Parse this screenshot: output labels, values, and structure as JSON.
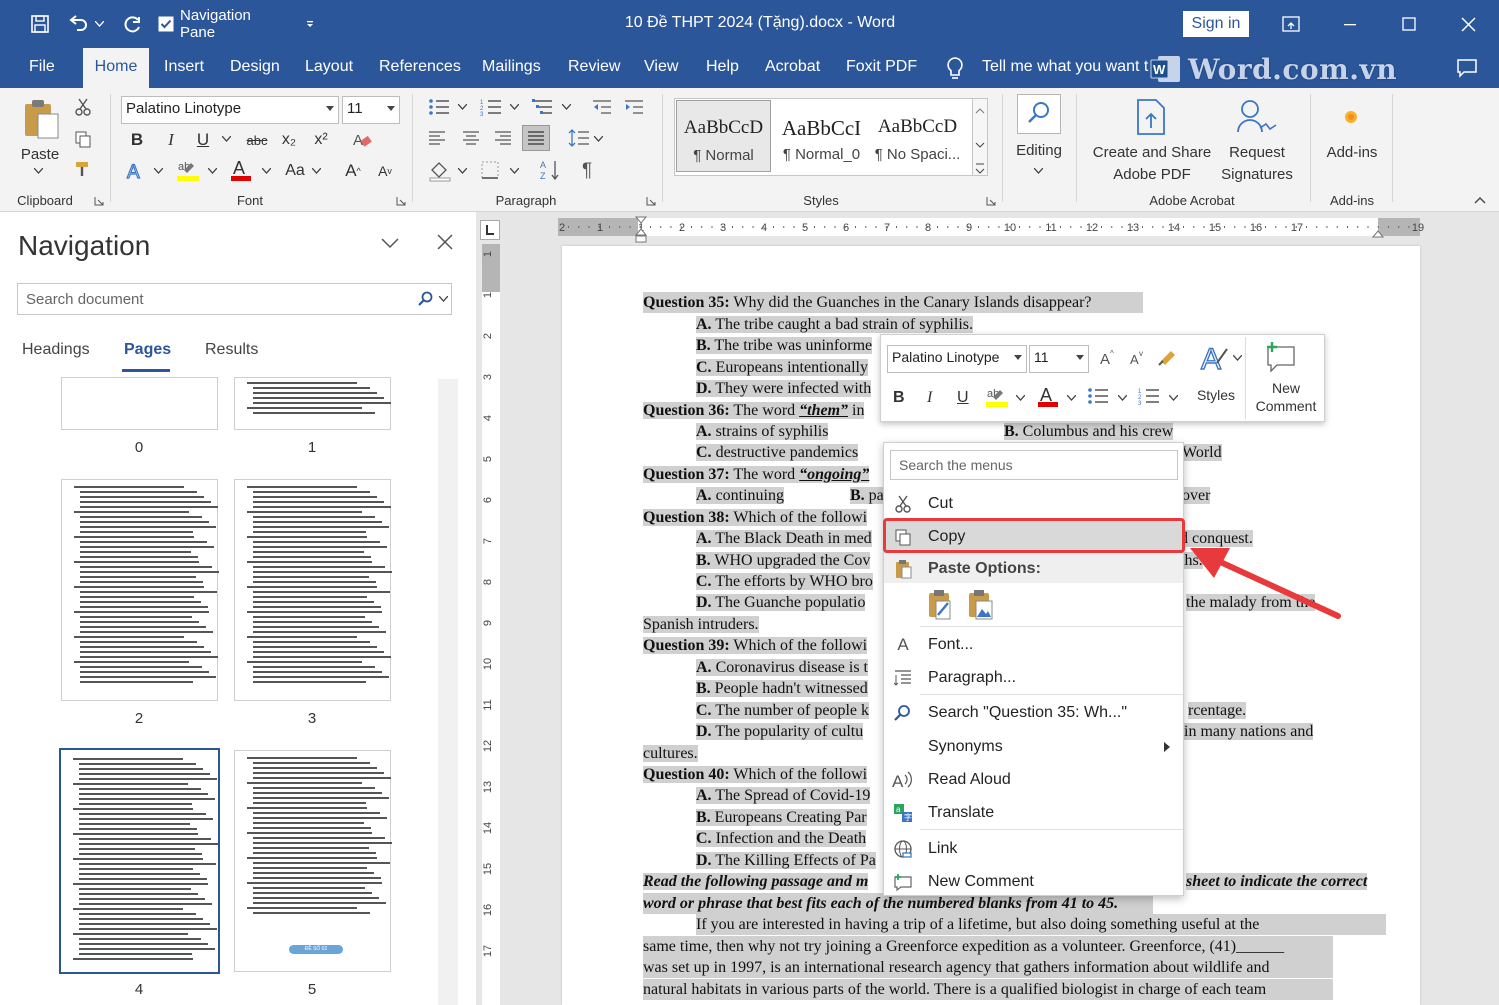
{
  "title_bar": {
    "qat_navigation_pane": "Navigation Pane",
    "document_title": "10 Đề THPT 2024 (Tặng).docx  -  Word",
    "sign_in": "Sign in"
  },
  "tabs": [
    "File",
    "Home",
    "Insert",
    "Design",
    "Layout",
    "References",
    "Mailings",
    "Review",
    "View",
    "Help",
    "Acrobat",
    "Foxit PDF"
  ],
  "tell_me": "Tell me what you want t",
  "watermark": "Word.com.vn",
  "ribbon": {
    "clipboard": {
      "paste": "Paste",
      "label": "Clipboard"
    },
    "font": {
      "name": "Palatino Linotype",
      "size": "11",
      "label": "Font",
      "bold": "B",
      "italic": "I",
      "underline": "U",
      "strike": "abc",
      "sub": "x₂",
      "sup": "x²",
      "change_case": "Aa",
      "grow": "A",
      "shrink": "A"
    },
    "paragraph": {
      "label": "Paragraph"
    },
    "styles": {
      "label": "Styles",
      "items": [
        {
          "preview": "AaBbCcD",
          "name": "¶ Normal"
        },
        {
          "preview": "AaBbCcI",
          "name": "¶ Normal_0"
        },
        {
          "preview": "AaBbCcD",
          "name": "¶ No Spaci..."
        }
      ]
    },
    "editing": {
      "label": "Editing"
    },
    "adobe": {
      "create_share": "Create and Share Adobe PDF",
      "request": "Request Signatures",
      "label": "Adobe Acrobat"
    },
    "addins": {
      "button": "Add-ins",
      "label": "Add-ins"
    }
  },
  "navigation": {
    "title": "Navigation",
    "search_placeholder": "Search document",
    "tabs": [
      "Headings",
      "Pages",
      "Results"
    ],
    "active_tab": "Pages",
    "page_numbers": [
      "0",
      "1",
      "2",
      "3",
      "4",
      "5"
    ],
    "selected_page": "4",
    "thumb_badge": "ĐỀ SỐ 02"
  },
  "ruler": {
    "h_ticks": [
      "2",
      "1",
      "1",
      "2",
      "3",
      "4",
      "5",
      "6",
      "7",
      "8",
      "9",
      "10",
      "11",
      "12",
      "13",
      "14",
      "15",
      "16",
      "17",
      "19"
    ],
    "v_ticks": [
      "1",
      "1",
      "2",
      "3",
      "4",
      "5",
      "6",
      "7",
      "8",
      "9",
      "10",
      "11",
      "12",
      "13",
      "14",
      "15",
      "16",
      "17"
    ]
  },
  "document": {
    "lines": [
      {
        "b": "Question 35:",
        "t": " Why did the Guanches in the Canary Islands disappear?"
      },
      {
        "b": "A.",
        "t": " The tribe caught a bad strain of syphilis."
      },
      {
        "b": "B.",
        "t": " The tribe was uninforme"
      },
      {
        "b": "C.",
        "t": "  Europeans intentionally"
      },
      {
        "b": "D.",
        "t": " They were infected with"
      },
      {
        "b": "Question 36:",
        "t": " The word ",
        "u": "“them”",
        "t2": " in"
      },
      {
        "b": "A.",
        "t": " strains of syphilis",
        "b2": "B.",
        "t2": " Columbus and his crew"
      },
      {
        "b": "C.",
        "t": " destructive pandemics",
        "t2": "World"
      },
      {
        "b": "Question 37:",
        "t": " The word ",
        "u": "“ongoing”"
      },
      {
        "b": "A.",
        "t": " continuing",
        "b2": "B.",
        "t2": " pa",
        "t3": "over"
      },
      {
        "b": "Question 38:",
        "t": " Which of the followi"
      },
      {
        "b": "A.",
        "t": " The Black Death in med",
        "t2": "d conquest."
      },
      {
        "b": "B.",
        "t": " WHO upgraded the Cov",
        "t2": "ths."
      },
      {
        "b": "C.",
        "t": " The efforts by WHO bro"
      },
      {
        "b": "D.",
        "t": " The Guanche populatio",
        "t2": "the malady from the"
      },
      {
        "t": "Spanish intruders."
      },
      {
        "b": "Question 39:",
        "t": " Which of the followi"
      },
      {
        "b": "A.",
        "t": " Coronavirus disease is t"
      },
      {
        "b": "B.",
        "t": " People hadn't witnessed"
      },
      {
        "b": "C.",
        "t": " The number of people k",
        "t2": "rcentage."
      },
      {
        "b": "D.",
        "t": " The popularity of cultu",
        "t2": "in many nations and"
      },
      {
        "t": "cultures."
      },
      {
        "b": "Question 40:",
        "t": " Which of the followi"
      },
      {
        "b": "A.",
        "t": " The Spread of Covid-19"
      },
      {
        "b": "B.",
        "t": " Europeans Creating Par"
      },
      {
        "b": "C.",
        "t": " Infection and the Death"
      },
      {
        "b": "D.",
        "t": " The Killing Effects of Pa"
      },
      {
        "i": "Read the following passage and m",
        "i2": "sheet to indicate the correct"
      },
      {
        "i": "word or phrase that best fits each of the numbered blanks from 41 to 45."
      },
      {
        "t": "If you are interested in having a trip of a lifetime, but also doing something useful at the"
      },
      {
        "t": "same time, then why not try joining a Greenforce expedition as a volunteer. Greenforce, (41)______"
      },
      {
        "t": "was set up in 1997, is an international research agency that gathers information about wildlife and"
      },
      {
        "t": "natural habitats in various parts of the world. There is a qualified biologist in charge of each team"
      }
    ]
  },
  "mini_toolbar": {
    "font": "Palatino Linotype",
    "size": "11",
    "styles": "Styles",
    "new_comment": "New Comment"
  },
  "context_menu": {
    "search_placeholder": "Search the menus",
    "cut": "Cut",
    "copy": "Copy",
    "paste_options": "Paste Options:",
    "font": "Font...",
    "paragraph": "Paragraph...",
    "search": "Search \"Question 35: Wh...\"",
    "synonyms": "Synonyms",
    "read_aloud": "Read Aloud",
    "translate": "Translate",
    "link": "Link",
    "new_comment": "New Comment"
  },
  "colors": {
    "word_blue": "#2b579a",
    "highlight_red": "#e8393d",
    "selection_gray": "#d0d0d0"
  }
}
